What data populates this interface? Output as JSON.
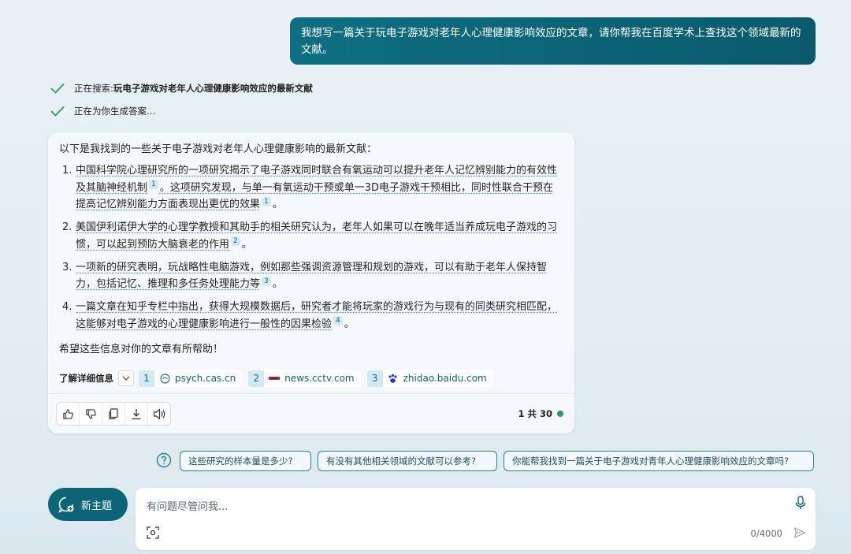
{
  "user_message": "我想写一篇关于玩电子游戏对老年人心理健康影响效应的文章，请你帮我在百度学术上查找这个领域最新的文献。",
  "status": [
    {
      "prefix": "正在搜索: ",
      "query": "玩电子游戏对老年人心理健康影响效应的最新文献"
    },
    {
      "prefix": "正在为你生成答案…",
      "query": ""
    }
  ],
  "answer": {
    "intro": "以下是我找到的一些关于电子游戏对老年人心理健康影响的最新文献：",
    "items": [
      {
        "num": "1.",
        "part1": "中国科学院心理研究所的一项研究揭示了电子游戏同时联合有氧运动可以提升老年人记忆辨别能力的有效性及其脑神经机制",
        "cite1": "1",
        "part2": "。这项研究发现，与单一有氧运动干预或单一3D电子游戏干预相比，同时性联合干预在提高记忆辨别能力方面表现出更优的效果",
        "cite2": "1",
        "part3": "。"
      },
      {
        "num": "2.",
        "part1": "美国伊利诺伊大学的心理学教授和其助手的相关研究认为，老年人如果可以在晚年适当养成玩电子游戏的习惯，可以起到预防大脑衰老的作用",
        "cite1": "2",
        "part2": "。"
      },
      {
        "num": "3.",
        "part1": "一项新的研究表明，玩战略性电脑游戏，例如那些强调资源管理和规划的游戏，可以有助于老年人保持智力，包括记忆、推理和多任务处理能力等",
        "cite1": "3",
        "part2": "。"
      },
      {
        "num": "4.",
        "part1": "一篇文章在知乎专栏中指出，获得大规模数据后，研究者才能将玩家的游戏行为与现有的同类研究相匹配，这能够对电子游戏的心理健康影响进行一般性的因果检验",
        "cite1": "4",
        "part2": "。"
      }
    ],
    "closing": "希望这些信息对你的文章有所帮助！"
  },
  "learn_more": {
    "label": "了解详细信息",
    "sources": [
      {
        "idx": "1",
        "domain": "psych.cas.cn",
        "icon": "psych-cas-icon"
      },
      {
        "idx": "2",
        "domain": "news.cctv.com",
        "icon": "cctv-icon"
      },
      {
        "idx": "3",
        "domain": "zhidao.baidu.com",
        "icon": "baidu-paw-icon"
      }
    ]
  },
  "page_count": "1 共 30",
  "suggestions": [
    "这些研究的样本量是多少?",
    "有没有其他相关领域的文献可以参考?",
    "你能帮我找到一篇关于电子游戏对青年人心理健康影响效应的文章吗?"
  ],
  "new_topic_label": "新主题",
  "input": {
    "placeholder": "有问题尽管问我...",
    "counter": "0/4000"
  },
  "colors": {
    "accent": "#0c6577",
    "cite_bg": "#d4eaf2",
    "online_dot": "#2c9b57"
  }
}
